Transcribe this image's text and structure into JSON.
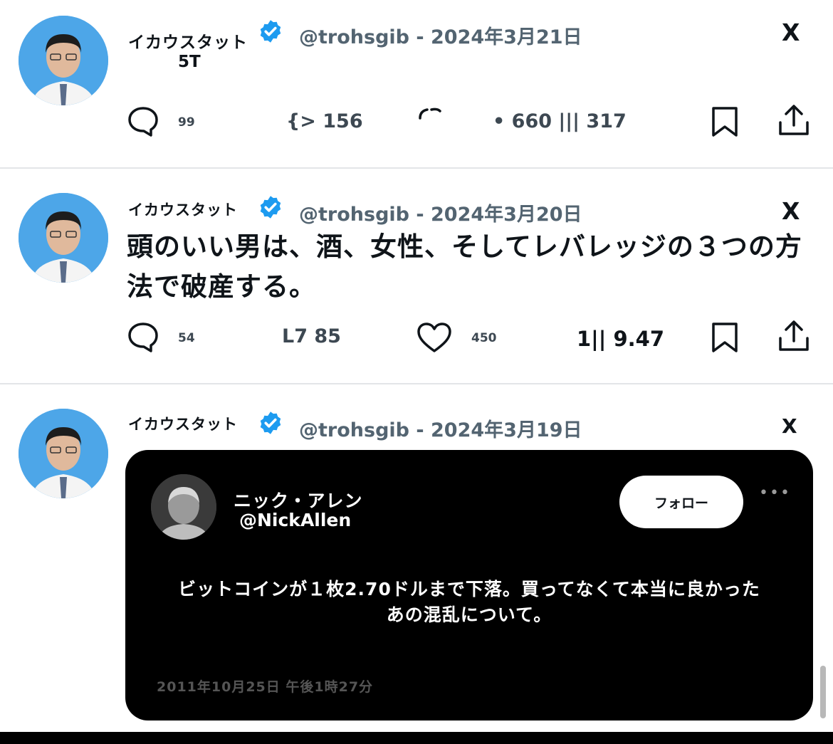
{
  "posts": [
    {
      "display_name": "イカウスタット",
      "sub_name": "5T",
      "handle": "@trohsgib",
      "separator": "-",
      "date": "2024年3月21日",
      "close_label": "X",
      "body": "",
      "replies": "99",
      "reposts": "{> 156",
      "likes": "",
      "views": "• 660 ||| 317"
    },
    {
      "display_name": "イカウスタット",
      "handle": "@trohsgib",
      "separator": "-",
      "date": "2024年3月20日",
      "close_label": "X",
      "body": "頭のいい男は、酒、女性、そしてレバレッジの３つの方法で破産する。",
      "replies": "54",
      "reposts": "L7 85",
      "likes": "450",
      "views": "1|| 9.47"
    },
    {
      "display_name": "イカウスタット",
      "handle": "@trohsgib",
      "separator": "-",
      "date": "2024年3月19日",
      "close_label": "X",
      "quote": {
        "name": "ニック・アレン",
        "handle": "@NickAllen",
        "follow_label": "フォロー",
        "more": "•••",
        "text_line1": "ビットコインが１枚2.70ドルまで下落。買ってなくて本当に良かった",
        "text_line2": "あの混乱について。",
        "date": "2011年10月25日 午後1時27分"
      }
    }
  ],
  "icons": {
    "verified": "verified-badge-icon",
    "reply": "reply-icon",
    "repost": "repost-icon",
    "like": "heart-icon",
    "views": "views-icon",
    "bookmark": "bookmark-icon",
    "share": "share-icon"
  },
  "colors": {
    "verified_blue": "#1d9bf0",
    "avatar_bg": "#4da6e8",
    "meta_gray": "#536471",
    "quote_bg": "#000000"
  }
}
